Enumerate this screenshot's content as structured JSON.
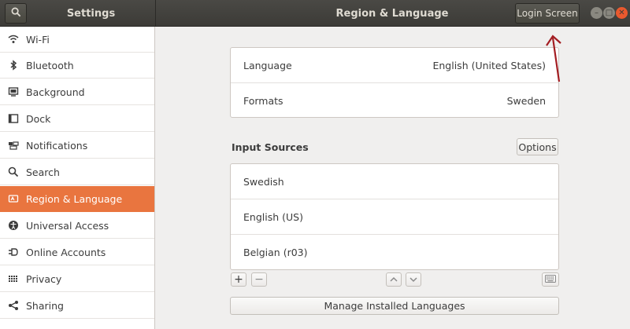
{
  "header": {
    "left_title": "Settings",
    "title": "Region & Language",
    "login_button": "Login Screen"
  },
  "sidebar": {
    "items": [
      {
        "label": "Wi-Fi",
        "icon": "wifi-icon"
      },
      {
        "label": "Bluetooth",
        "icon": "bluetooth-icon"
      },
      {
        "label": "Background",
        "icon": "background-icon"
      },
      {
        "label": "Dock",
        "icon": "dock-icon"
      },
      {
        "label": "Notifications",
        "icon": "notifications-icon"
      },
      {
        "label": "Search",
        "icon": "search-icon"
      },
      {
        "label": "Region & Language",
        "icon": "region-icon",
        "active": true
      },
      {
        "label": "Universal Access",
        "icon": "universal-access-icon"
      },
      {
        "label": "Online Accounts",
        "icon": "online-accounts-icon"
      },
      {
        "label": "Privacy",
        "icon": "privacy-icon"
      },
      {
        "label": "Sharing",
        "icon": "sharing-icon"
      }
    ]
  },
  "main": {
    "language": {
      "label": "Language",
      "value": "English (United States)"
    },
    "formats": {
      "label": "Formats",
      "value": "Sweden"
    },
    "input_sources": {
      "title": "Input Sources",
      "options_button": "Options",
      "items": [
        "Swedish",
        "English (US)",
        "Belgian (r03)"
      ]
    },
    "manage_button": "Manage Installed Languages"
  },
  "colors": {
    "accent": "#e9753f",
    "headerbar": "#3c3b37",
    "annotation_arrow": "#a31d22"
  }
}
